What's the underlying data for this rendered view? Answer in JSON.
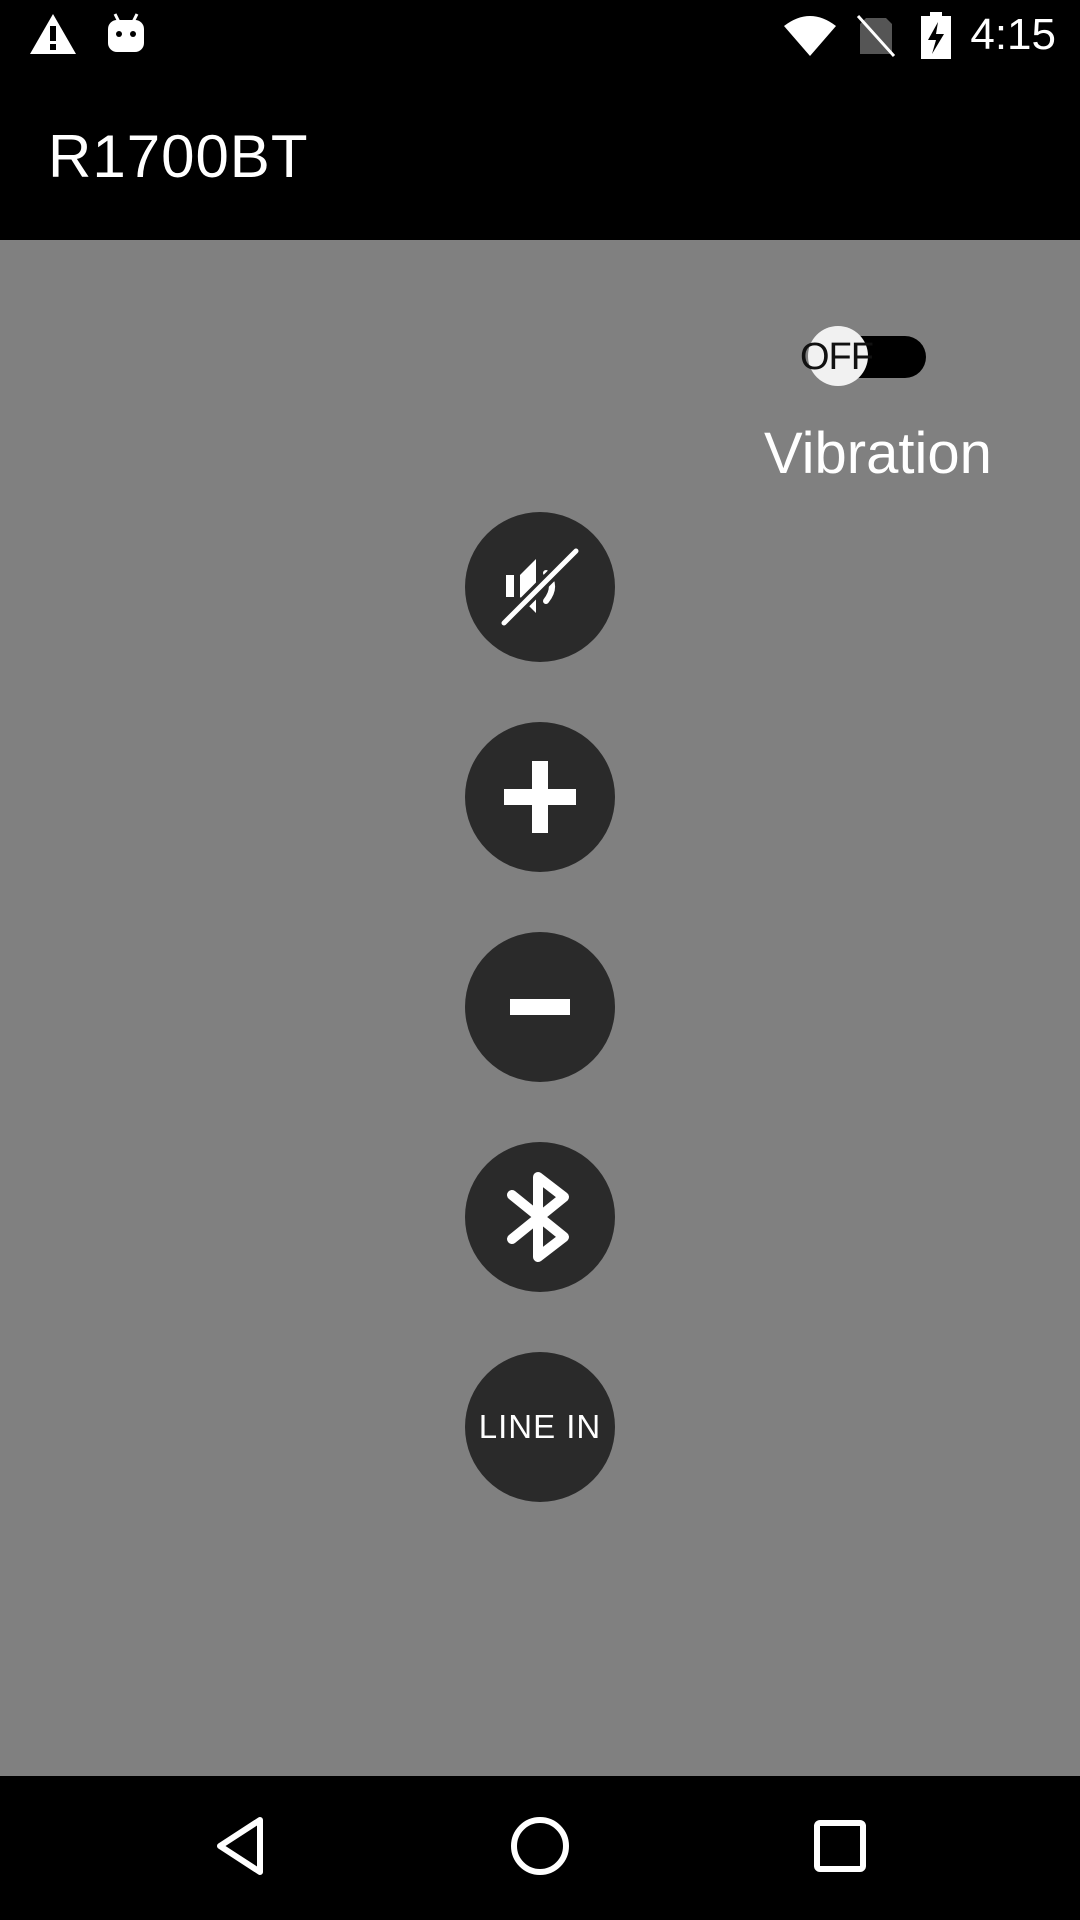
{
  "status_bar": {
    "time": "4:15",
    "icons": [
      "warning-icon",
      "android-debug-icon",
      "wifi-icon",
      "no-sim-icon",
      "battery-charging-icon"
    ]
  },
  "app_bar": {
    "title": "R1700BT"
  },
  "vibration": {
    "switch_state": "OFF",
    "label": "Vibration"
  },
  "controls": [
    {
      "name": "mute",
      "icon": "mute-icon"
    },
    {
      "name": "volume-up",
      "icon": "plus-icon"
    },
    {
      "name": "volume-down",
      "icon": "minus-icon"
    },
    {
      "name": "bluetooth",
      "icon": "bluetooth-icon"
    },
    {
      "name": "line-in",
      "label": "LINE IN"
    }
  ],
  "colors": {
    "content_background": "#808080",
    "button_background": "#2a2a2a",
    "bars": "#000000"
  },
  "nav_bar": {
    "icons": [
      "back-icon",
      "home-icon",
      "recents-icon"
    ]
  }
}
